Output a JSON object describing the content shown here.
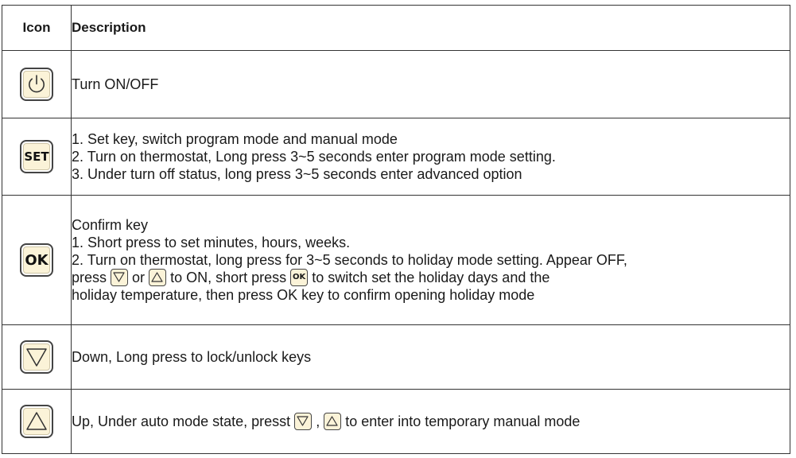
{
  "header": {
    "icon": "Icon",
    "description": "Description"
  },
  "rows": [
    {
      "icon": "power-icon",
      "lines": [
        "Turn ON/OFF"
      ]
    },
    {
      "icon": "set-key-icon",
      "icon_text": "SET",
      "lines": [
        "1. Set key, switch program mode and manual mode",
        "2. Turn on thermostat, Long press 3~5 seconds enter program mode setting.",
        "3. Under turn off status, long press 3~5 seconds enter advanced option"
      ]
    },
    {
      "icon": "ok-key-icon",
      "icon_text": "OK",
      "lines": [
        "Confirm key",
        "1. Short press to set minutes, hours, weeks.",
        "2. Turn on thermostat, long press for 3~5 seconds to holiday mode setting. Appear OFF,"
      ],
      "line4": {
        "part1": "press",
        "part2": "or",
        "part3": "to ON, short press",
        "part4": "to switch set the holiday days and the"
      },
      "line5": "holiday temperature, then press OK key to confirm opening holiday mode"
    },
    {
      "icon": "down-arrow-icon",
      "lines": [
        "Down, Long press to lock/unlock keys"
      ]
    },
    {
      "icon": "up-arrow-icon",
      "line": {
        "part1": "Up, Under auto mode state, presst",
        "part2": ",",
        "part3": "to enter into temporary manual mode"
      }
    }
  ],
  "colors": {
    "key_fill": "#fbf3d8",
    "border": "#333333",
    "text": "#1a1a1a"
  }
}
